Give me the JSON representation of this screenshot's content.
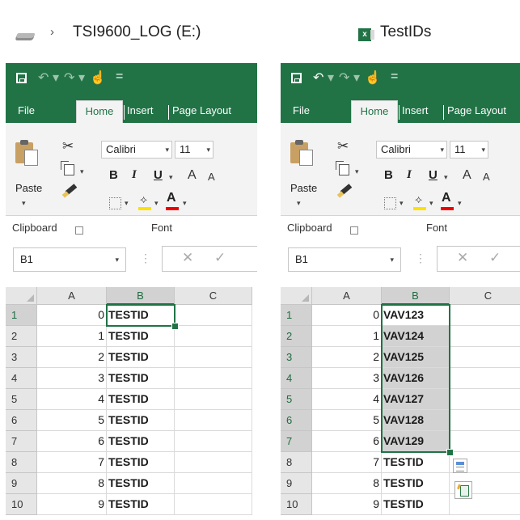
{
  "left_window": {
    "breadcrumb_chevron": "›",
    "path": "TSI9600_LOG (E:)",
    "drive_icon": "usb-drive-icon",
    "tabs": [
      "File",
      "Home",
      "Insert",
      "Page Layout"
    ],
    "active_tab": "Home",
    "paste_label": "Paste",
    "font_name": "Calibri",
    "font_size": "11",
    "bold": "B",
    "italic": "I",
    "underline": "U",
    "grow_font": "A",
    "shrink_font": "A",
    "font_color_letter": "A",
    "group_clipboard": "Clipboard",
    "group_font": "Font",
    "name_box": "B1",
    "columns": [
      "A",
      "B",
      "C"
    ],
    "rows": [
      {
        "n": "1",
        "a": "0",
        "b": "TESTID"
      },
      {
        "n": "2",
        "a": "1",
        "b": "TESTID"
      },
      {
        "n": "3",
        "a": "2",
        "b": "TESTID"
      },
      {
        "n": "4",
        "a": "3",
        "b": "TESTID"
      },
      {
        "n": "5",
        "a": "4",
        "b": "TESTID"
      },
      {
        "n": "6",
        "a": "5",
        "b": "TESTID"
      },
      {
        "n": "7",
        "a": "6",
        "b": "TESTID"
      },
      {
        "n": "8",
        "a": "7",
        "b": "TESTID"
      },
      {
        "n": "9",
        "a": "8",
        "b": "TESTID"
      },
      {
        "n": "10",
        "a": "9",
        "b": "TESTID"
      }
    ]
  },
  "right_window": {
    "title": "TestIDs",
    "doc_icon_letter": "x",
    "tabs": [
      "File",
      "Home",
      "Insert",
      "Page Layout"
    ],
    "active_tab": "Home",
    "paste_label": "Paste",
    "font_name": "Calibri",
    "font_size": "11",
    "bold": "B",
    "italic": "I",
    "underline": "U",
    "grow_font": "A",
    "shrink_font": "A",
    "font_color_letter": "A",
    "group_clipboard": "Clipboard",
    "group_font": "Font",
    "name_box": "B1",
    "columns": [
      "A",
      "B",
      "C"
    ],
    "rows": [
      {
        "n": "1",
        "a": "0",
        "b": "VAV123"
      },
      {
        "n": "2",
        "a": "1",
        "b": "VAV124"
      },
      {
        "n": "3",
        "a": "2",
        "b": "VAV125"
      },
      {
        "n": "4",
        "a": "3",
        "b": "VAV126"
      },
      {
        "n": "5",
        "a": "4",
        "b": "VAV127"
      },
      {
        "n": "6",
        "a": "5",
        "b": "VAV128"
      },
      {
        "n": "7",
        "a": "6",
        "b": "VAV129"
      },
      {
        "n": "8",
        "a": "7",
        "b": "TESTID"
      },
      {
        "n": "9",
        "a": "8",
        "b": "TESTID"
      },
      {
        "n": "10",
        "a": "9",
        "b": "TESTID"
      }
    ],
    "selected_rows": 7
  },
  "colors": {
    "excel_green": "#217346",
    "selection_fill": "#d2d2d2",
    "font_color_red": "#e00000",
    "highlight_yellow": "#fde100"
  }
}
